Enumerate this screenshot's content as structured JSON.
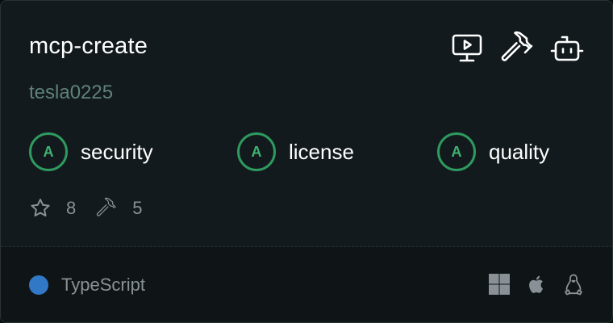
{
  "card": {
    "title": "mcp-create",
    "author": "tesla0225",
    "top_icons": [
      "monitor-play-icon",
      "hammer-icon",
      "bot-icon"
    ],
    "scores": [
      {
        "grade": "A",
        "label": "security"
      },
      {
        "grade": "A",
        "label": "license"
      },
      {
        "grade": "A",
        "label": "quality"
      }
    ],
    "stats": {
      "stars": "8",
      "tools": "5"
    },
    "language": {
      "name": "TypeScript",
      "color": "#3178c6"
    },
    "platforms": [
      "windows-icon",
      "apple-icon",
      "linux-icon"
    ],
    "colors": {
      "grade_ring": "#2e9a5f",
      "grade_text": "#3fb371",
      "author": "#5f827a",
      "muted": "#8a9196"
    }
  }
}
